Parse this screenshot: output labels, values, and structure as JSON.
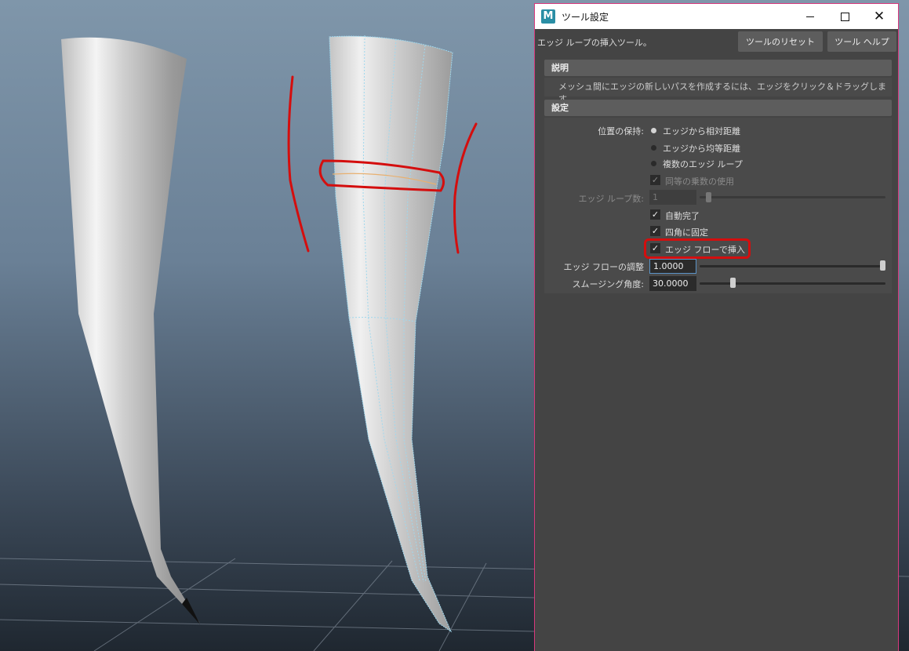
{
  "window": {
    "app_icon_letter": "M",
    "title": "ツール設定",
    "minimize_icon": "minimize-icon",
    "maximize_icon": "maximize-icon",
    "close_icon": "close-icon",
    "close_glyph": "✕"
  },
  "header": {
    "tool_name": "エッジ ループの挿入ツール。",
    "reset_label": "ツールのリセット",
    "help_label": "ツール ヘルプ"
  },
  "description": {
    "heading": "説明",
    "text": "メッシュ間にエッジの新しいパスを作成するには、エッジをクリック＆ドラッグします。"
  },
  "settings": {
    "heading": "設定",
    "position_label": "位置の保持:",
    "radio_options": [
      {
        "label": "エッジから相対距離",
        "selected": true
      },
      {
        "label": "エッジから均等距離",
        "selected": false
      },
      {
        "label": "複数のエッジ ループ",
        "selected": false
      }
    ],
    "use_equal_multiplier": {
      "label": "同等の乗数の使用",
      "checked": true,
      "enabled": false
    },
    "edge_loop_count": {
      "label": "エッジ ループ数:",
      "value": "1",
      "enabled": false,
      "slider": 0.0
    },
    "auto_complete": {
      "label": "自動完了",
      "checked": true
    },
    "fix_quads": {
      "label": "四角に固定",
      "checked": true
    },
    "insert_with_edge_flow": {
      "label": "エッジ フローで挿入",
      "checked": true
    },
    "edge_flow_adjust": {
      "label": "エッジ フローの調整",
      "value": "1.0000",
      "slider": 1.0
    },
    "smoothing_angle": {
      "label": "スムージング角度:",
      "value": "30.0000",
      "slider": 0.1667
    },
    "check_glyph": "✓"
  },
  "colors": {
    "window_border": "#d9387c",
    "panel_bg": "#444444",
    "annotation_red": "#d40e0e",
    "wire_cyan": "#9fd8ee",
    "selected_edge": "#e8b070"
  }
}
